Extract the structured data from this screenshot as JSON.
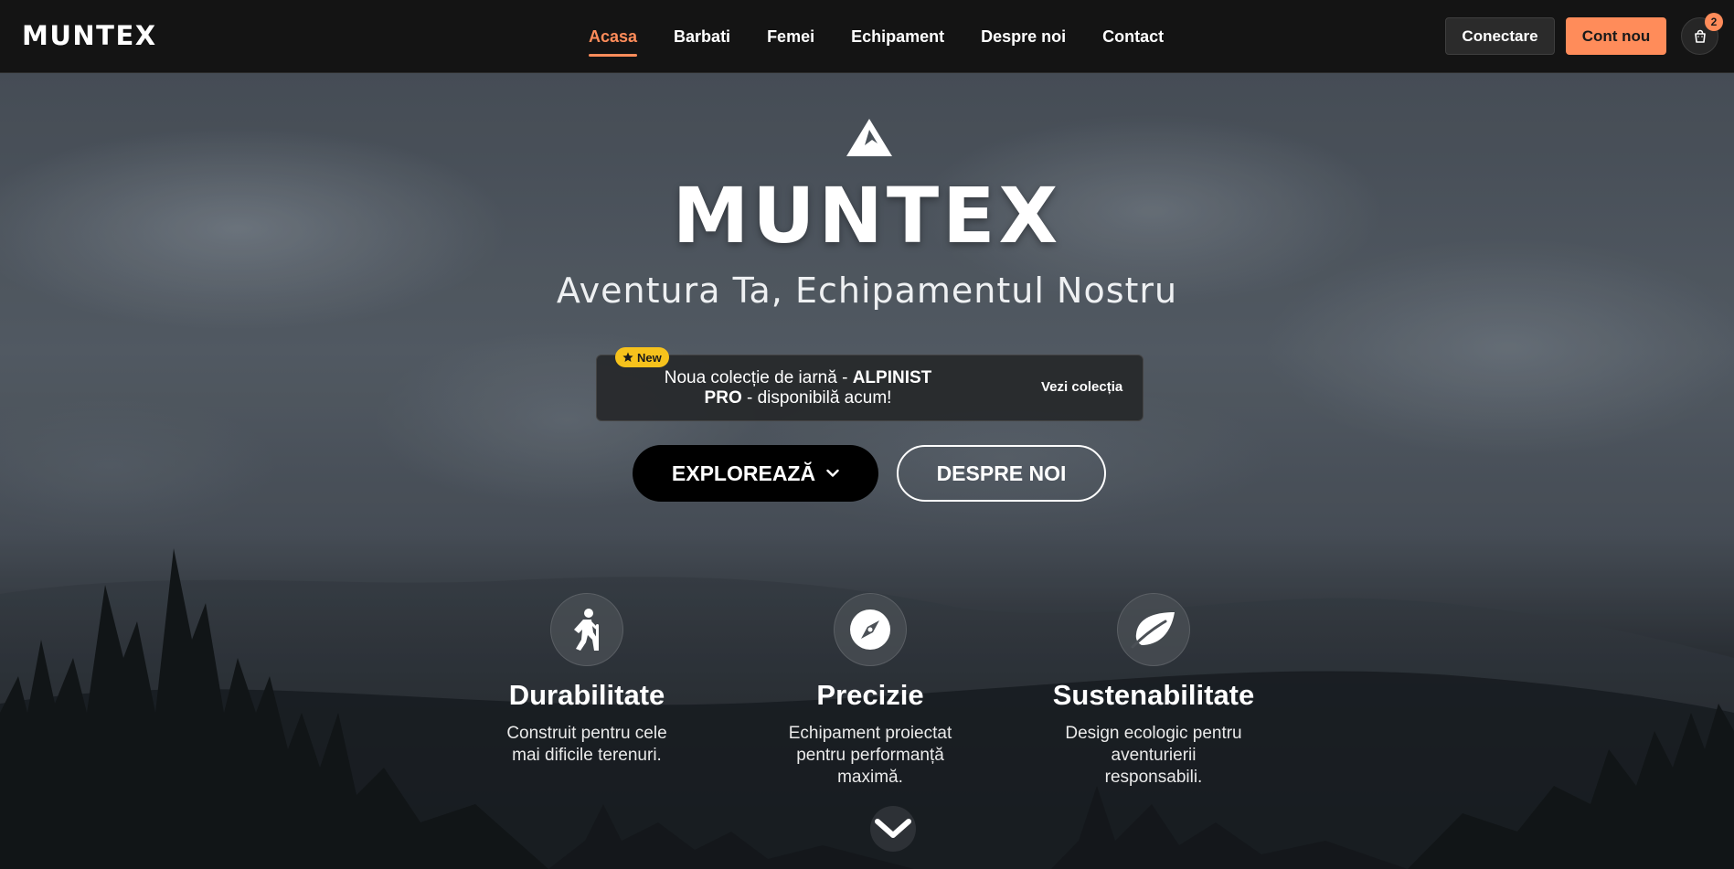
{
  "nav": {
    "brand": "MUNTEX",
    "links": [
      {
        "label": "Acasa",
        "active": true
      },
      {
        "label": "Barbati",
        "active": false
      },
      {
        "label": "Femei",
        "active": false
      },
      {
        "label": "Echipament",
        "active": false
      },
      {
        "label": "Despre noi",
        "active": false
      },
      {
        "label": "Contact",
        "active": false
      }
    ],
    "login_label": "Conectare",
    "register_label": "Cont nou",
    "cart_count": "2",
    "cart_icon": "shopping-bag-icon"
  },
  "hero": {
    "logo_icon": "mountain-icon",
    "title": "MUNTEX",
    "subtitle": "Aventura Ta, Echipamentul Nostru",
    "promo": {
      "badge": "New",
      "badge_icon": "star-icon",
      "text_before": "Noua colecție de iarnă - ",
      "text_bold": "ALPINIST PRO",
      "text_after": " - disponibilă acum!",
      "link": "Vezi colecția"
    },
    "explore_label": "EXPLOREAZĂ",
    "about_label": "DESPRE NOI"
  },
  "features": [
    {
      "icon": "hiker-icon",
      "title": "Durabilitate",
      "desc": "Construit pentru cele mai dificile terenuri."
    },
    {
      "icon": "compass-icon",
      "title": "Precizie",
      "desc": "Echipament proiectat pentru performanță maximă."
    },
    {
      "icon": "leaf-icon",
      "title": "Sustenabilitate",
      "desc": "Design ecologic pentru aventurierii responsabili."
    }
  ],
  "colors": {
    "accent": "#ff8c5a",
    "badge": "#f6c21c",
    "nav_bg": "#141414"
  }
}
